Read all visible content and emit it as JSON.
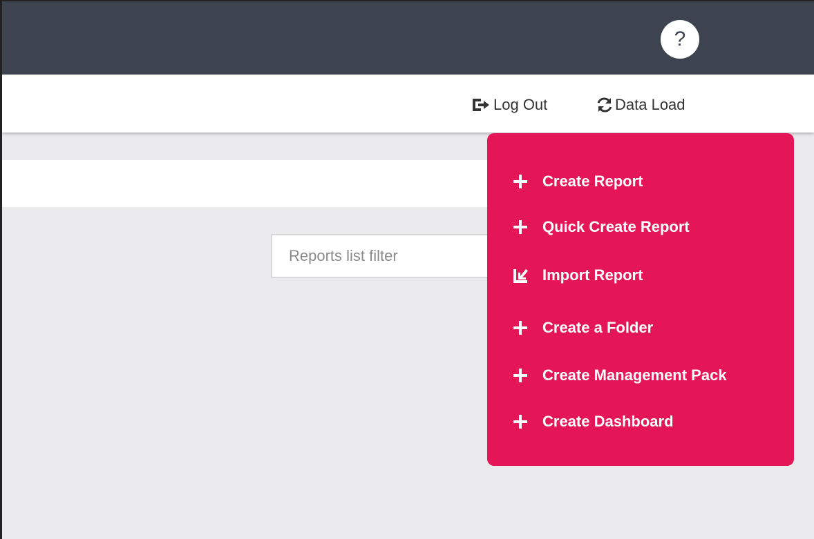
{
  "header": {
    "help_label": "?"
  },
  "subbar": {
    "logout_label": "Log Out",
    "dataload_label": "Data Load"
  },
  "filter": {
    "placeholder": "Reports list filter",
    "value": ""
  },
  "menu": {
    "items": [
      {
        "label": "Create Report",
        "icon": "plus-icon"
      },
      {
        "label": "Quick Create Report",
        "icon": "plus-icon"
      },
      {
        "label": "Import Report",
        "icon": "import-icon"
      },
      {
        "label": "Create a Folder",
        "icon": "plus-icon"
      },
      {
        "label": "Create Management Pack",
        "icon": "plus-icon"
      },
      {
        "label": "Create Dashboard",
        "icon": "plus-icon"
      }
    ]
  },
  "colors": {
    "topbar": "#3e4350",
    "menu_bg": "#e51657",
    "content_bg": "#ebebed"
  }
}
